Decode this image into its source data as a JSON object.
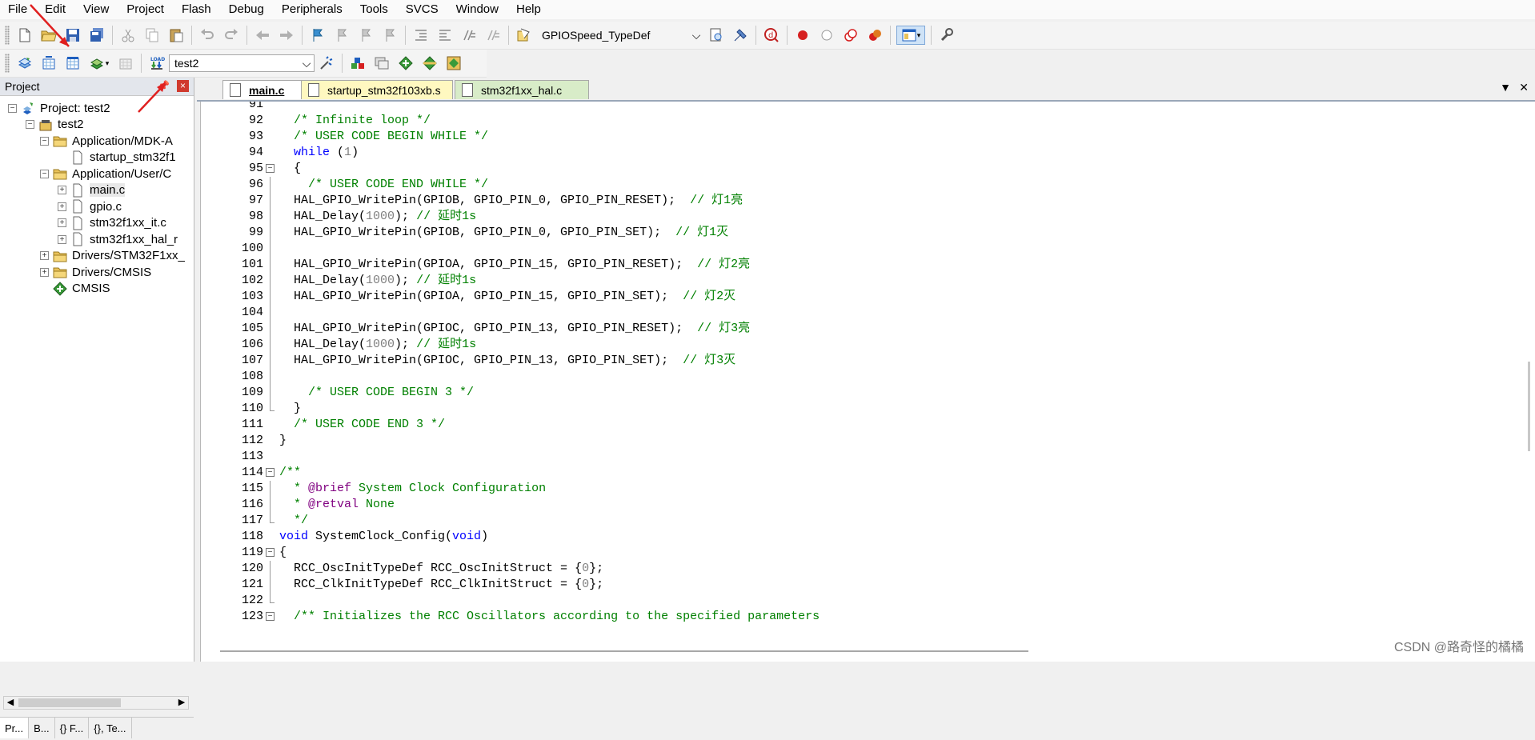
{
  "menu": [
    "File",
    "Edit",
    "View",
    "Project",
    "Flash",
    "Debug",
    "Peripherals",
    "Tools",
    "SVCS",
    "Window",
    "Help"
  ],
  "toolbar": {
    "function_combo_value": "GPIOSpeed_TypeDef",
    "target_combo_value": "test2",
    "colors": {
      "record": "#d62020",
      "accent": "#1e5fbf"
    }
  },
  "project_panel": {
    "title": "Project",
    "close_label": "×",
    "tree": [
      {
        "label": "Project: test2",
        "depth": 0,
        "icon": "project-icon"
      },
      {
        "label": "test2",
        "depth": 1,
        "icon": "target-icon"
      },
      {
        "label": "Application/MDK-A",
        "depth": 2,
        "icon": "folder-icon"
      },
      {
        "label": "startup_stm32f1",
        "depth": 3,
        "icon": "file-icon"
      },
      {
        "label": "Application/User/C",
        "depth": 2,
        "icon": "folder-icon"
      },
      {
        "label": "main.c",
        "depth": 3,
        "icon": "file-icon",
        "selected": true
      },
      {
        "label": "gpio.c",
        "depth": 3,
        "icon": "file-icon"
      },
      {
        "label": "stm32f1xx_it.c",
        "depth": 3,
        "icon": "file-icon"
      },
      {
        "label": "stm32f1xx_hal_r",
        "depth": 3,
        "icon": "file-icon"
      },
      {
        "label": "Drivers/STM32F1xx_",
        "depth": 2,
        "icon": "folder-icon"
      },
      {
        "label": "Drivers/CMSIS",
        "depth": 2,
        "icon": "folder-icon"
      },
      {
        "label": "CMSIS",
        "depth": 2,
        "icon": "cmsis-diamond-icon"
      }
    ],
    "bottom_tabs": [
      "Pr...",
      "B...",
      "{} F...",
      "{}, Te..."
    ]
  },
  "editor": {
    "tabs": [
      "main.c",
      "startup_stm32f103xb.s",
      "stm32f1xx_hal.c"
    ],
    "lines": [
      {
        "n": "91",
        "code": ""
      },
      {
        "n": "92",
        "code": "  /* Infinite loop */"
      },
      {
        "n": "93",
        "code": "  /* USER CODE BEGIN WHILE */"
      },
      {
        "n": "94",
        "code": "  while (1)"
      },
      {
        "n": "95",
        "code": "  {"
      },
      {
        "n": "96",
        "code": "    /* USER CODE END WHILE */"
      },
      {
        "n": "97",
        "code": "  HAL_GPIO_WritePin(GPIOB, GPIO_PIN_0, GPIO_PIN_RESET);  // 灯1亮"
      },
      {
        "n": "98",
        "code": "  HAL_Delay(1000); // 延时1s"
      },
      {
        "n": "99",
        "code": "  HAL_GPIO_WritePin(GPIOB, GPIO_PIN_0, GPIO_PIN_SET);  // 灯1灭"
      },
      {
        "n": "100",
        "code": ""
      },
      {
        "n": "101",
        "code": "  HAL_GPIO_WritePin(GPIOA, GPIO_PIN_15, GPIO_PIN_RESET);  // 灯2亮"
      },
      {
        "n": "102",
        "code": "  HAL_Delay(1000); // 延时1s"
      },
      {
        "n": "103",
        "code": "  HAL_GPIO_WritePin(GPIOA, GPIO_PIN_15, GPIO_PIN_SET);  // 灯2灭"
      },
      {
        "n": "104",
        "code": ""
      },
      {
        "n": "105",
        "code": "  HAL_GPIO_WritePin(GPIOC, GPIO_PIN_13, GPIO_PIN_RESET);  // 灯3亮"
      },
      {
        "n": "106",
        "code": "  HAL_Delay(1000); // 延时1s"
      },
      {
        "n": "107",
        "code": "  HAL_GPIO_WritePin(GPIOC, GPIO_PIN_13, GPIO_PIN_SET);  // 灯3灭"
      },
      {
        "n": "108",
        "code": ""
      },
      {
        "n": "109",
        "code": "    /* USER CODE BEGIN 3 */"
      },
      {
        "n": "110",
        "code": "  }"
      },
      {
        "n": "111",
        "code": "  /* USER CODE END 3 */"
      },
      {
        "n": "112",
        "code": "}"
      },
      {
        "n": "113",
        "code": ""
      },
      {
        "n": "114",
        "code": "/**"
      },
      {
        "n": "115",
        "code": "  * @brief System Clock Configuration"
      },
      {
        "n": "116",
        "code": "  * @retval None"
      },
      {
        "n": "117",
        "code": "  */"
      },
      {
        "n": "118",
        "code": "void SystemClock_Config(void)"
      },
      {
        "n": "119",
        "code": "{"
      },
      {
        "n": "120",
        "code": "  RCC_OscInitTypeDef RCC_OscInitStruct = {0};"
      },
      {
        "n": "121",
        "code": "  RCC_ClkInitTypeDef RCC_ClkInitStruct = {0};"
      },
      {
        "n": "122",
        "code": ""
      },
      {
        "n": "123",
        "code": "  /** Initializes the RCC Oscillators according to the specified parameters"
      }
    ]
  },
  "watermark": "CSDN @路奇怪的橘橘"
}
